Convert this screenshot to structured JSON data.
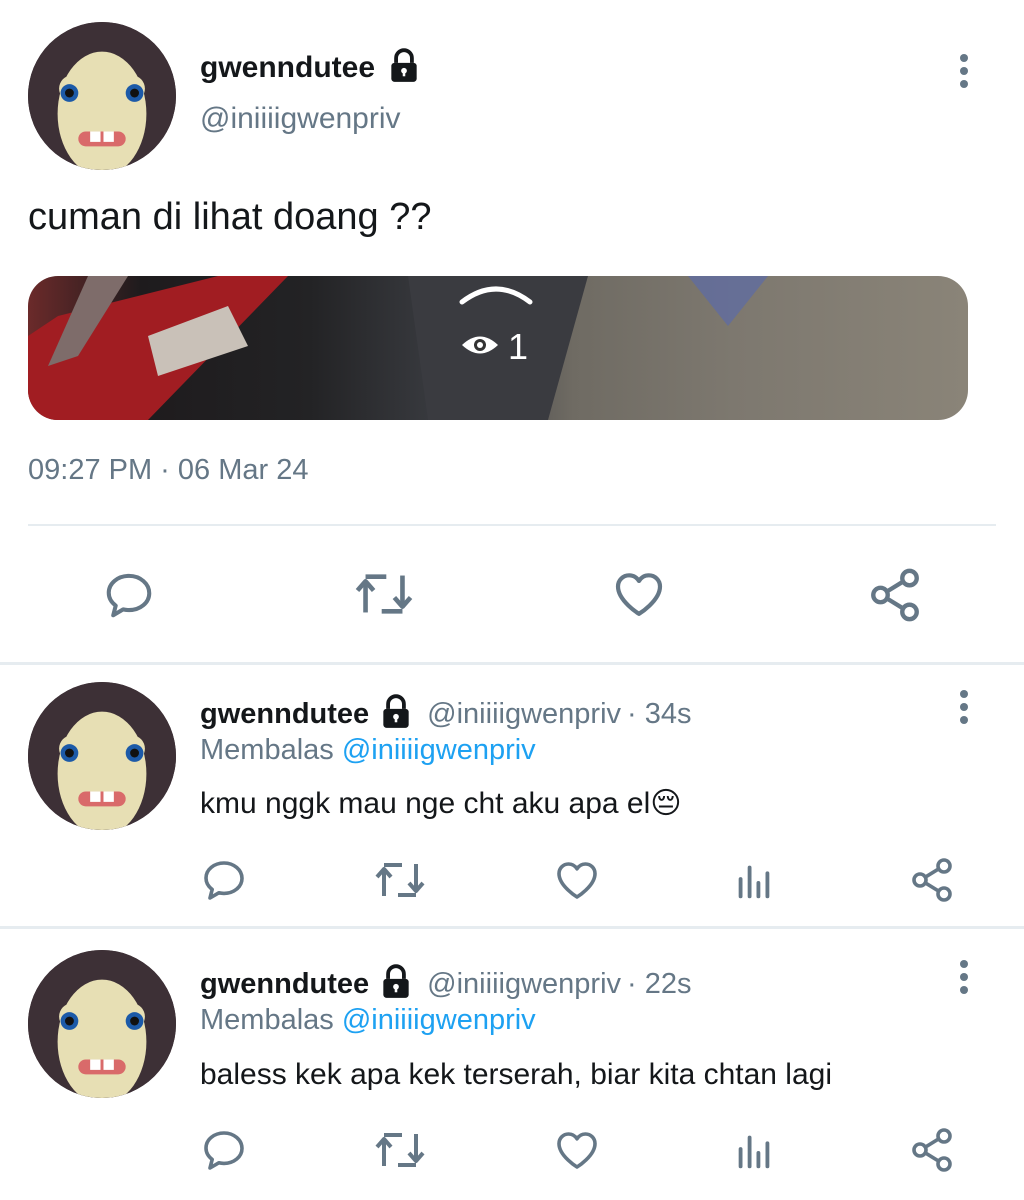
{
  "main_tweet": {
    "display_name": "gwenndutee",
    "handle": "@iniiiigwenpriv",
    "text": "cuman di lihat doang ??",
    "media_views": "1",
    "timestamp": "09:27 PM · 06 Mar 24"
  },
  "replies": [
    {
      "display_name": "gwenndutee",
      "handle": "@iniiiigwenpriv",
      "time_ago": "· 34s",
      "replying_label": "Membalas",
      "replying_to": "@iniiiigwenpriv",
      "text": "kmu nggk mau nge cht aku apa el😔"
    },
    {
      "display_name": "gwenndutee",
      "handle": "@iniiiigwenpriv",
      "time_ago": "· 22s",
      "replying_label": "Membalas",
      "replying_to": "@iniiiigwenpriv",
      "text": "baless kek apa kek terserah, biar kita chtan lagi"
    }
  ],
  "colors": {
    "icon_gray": "#657786",
    "mention_blue": "#1da1f2",
    "divider": "#e6ecf0"
  },
  "icons": [
    "lock-icon",
    "more-icon",
    "reply-icon",
    "retweet-icon",
    "like-icon",
    "share-icon",
    "analytics-icon",
    "eye-icon",
    "chevron-up-icon"
  ]
}
